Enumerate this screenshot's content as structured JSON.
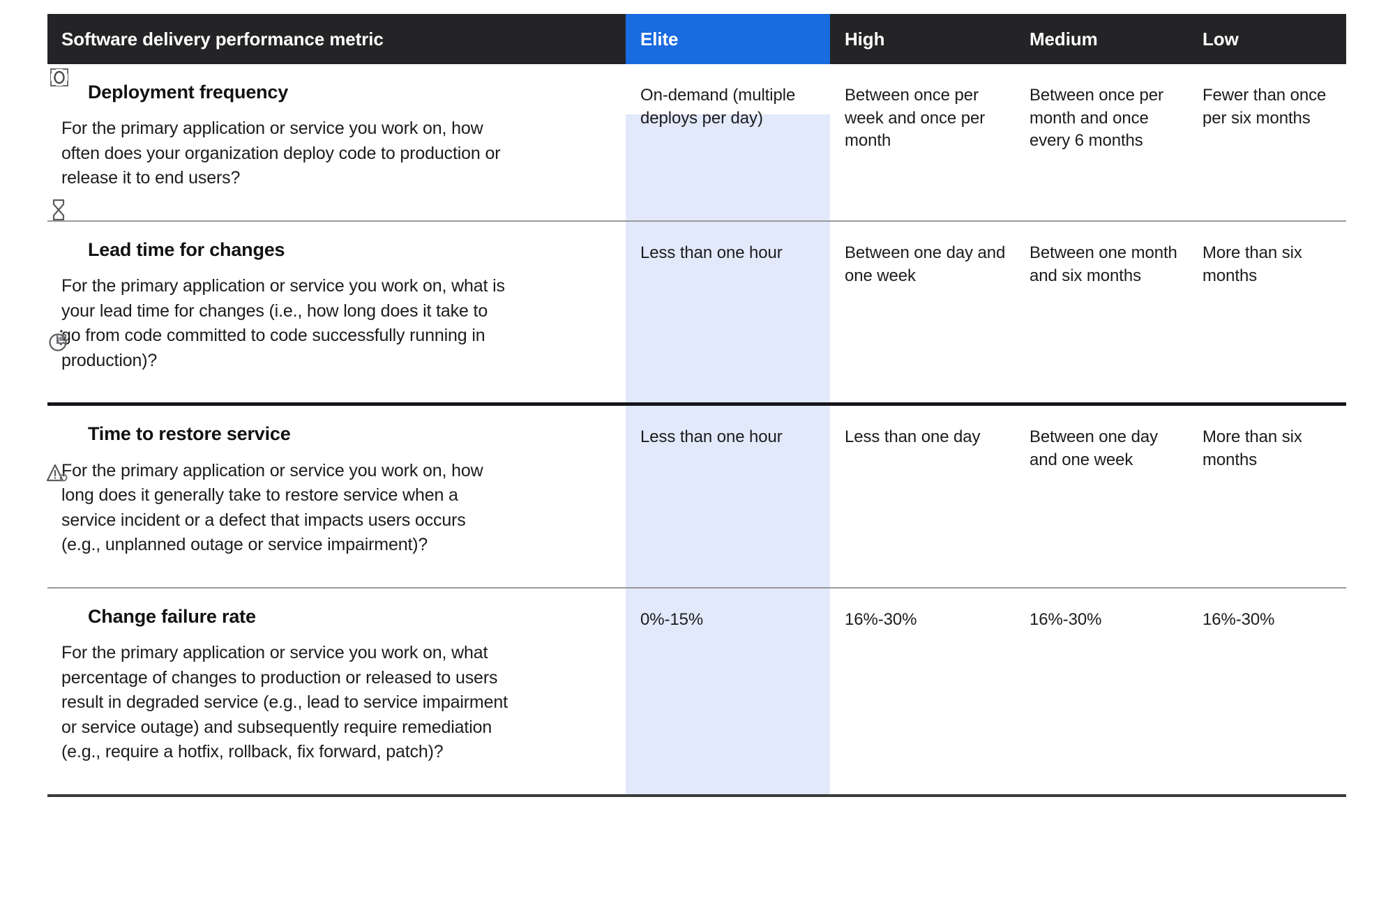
{
  "table": {
    "columns": [
      {
        "key": "metric",
        "label": "Software delivery performance metric",
        "highlight": false
      },
      {
        "key": "elite",
        "label": "Elite",
        "highlight": true
      },
      {
        "key": "high",
        "label": "High",
        "highlight": false
      },
      {
        "key": "medium",
        "label": "Medium",
        "highlight": false
      },
      {
        "key": "low",
        "label": "Low",
        "highlight": false
      }
    ],
    "rows": [
      {
        "icon": "deployment-icon",
        "title": "Deployment frequency",
        "description": "For the primary application or service you work on, how often does your organization deploy code to production or release it to end users?",
        "elite": "On-demand (multiple deploys per day)",
        "high": "Between once per week and once per month",
        "medium": "Between once per month and once every 6 months",
        "low": "Fewer than once per six months"
      },
      {
        "icon": "hourglass-icon",
        "title": "Lead time for changes",
        "description": "For the primary application or service you work on, what is your lead time for changes (i.e., how long does it take to go from code committed to code successfully running in production)?",
        "elite": "Less than one hour",
        "high": "Between one day and one week",
        "medium": "Between one month and six months",
        "low": "More than six months"
      },
      {
        "icon": "clock-restore-icon",
        "title": "Time to restore service",
        "description": "For the primary application or service you work on, how long does it generally take to restore service when a service incident or a defect that impacts users occurs (e.g., unplanned outage or service impairment)?",
        "elite": "Less than one hour",
        "high": "Less than one day",
        "medium": "Between one day and one week",
        "low": "More than six months"
      },
      {
        "icon": "warning-triangle-icon",
        "title": "Change failure rate",
        "description": "For the primary application or service you work on, what percentage of changes to production or released to users result in degraded service (e.g., lead to service impairment or service outage) and subsequently require remediation (e.g., require a hotfix, rollback, fix forward, patch)?",
        "elite": "0%-15%",
        "high": "16%-30%",
        "medium": "16%-30%",
        "low": "16%-30%"
      }
    ]
  },
  "colors": {
    "header_background": "#242427",
    "elite_header_background": "#1a6ae0",
    "elite_column_background": "#e1e9fb",
    "text_dark": "#1c1c1e",
    "divider_thin": "#9a9a9a",
    "divider_thick": "#15161a"
  }
}
